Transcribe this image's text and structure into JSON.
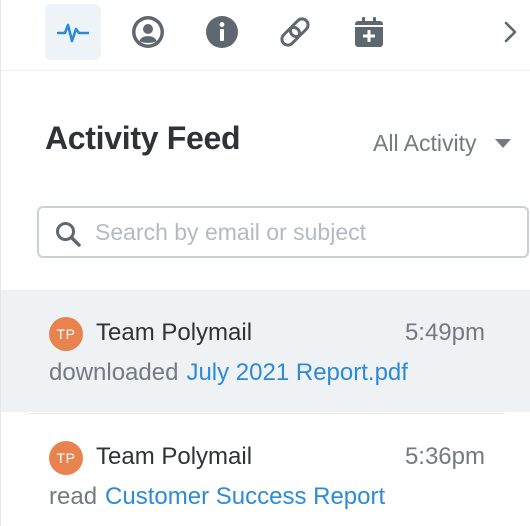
{
  "toolbar": {
    "tabs": [
      {
        "icon": "activity-icon",
        "active": true
      },
      {
        "icon": "profile-icon",
        "active": false
      },
      {
        "icon": "info-icon",
        "active": false
      },
      {
        "icon": "attachment-icon",
        "active": false
      },
      {
        "icon": "add-calendar-icon",
        "active": false
      }
    ],
    "more_icon": "chevron-right-icon"
  },
  "header": {
    "title": "Activity Feed",
    "filter_label": "All Activity"
  },
  "search": {
    "placeholder": "Search by email or subject",
    "value": ""
  },
  "feed": [
    {
      "avatar_initials": "TP",
      "name": "Team Polymail",
      "time": "5:49pm",
      "action": "downloaded",
      "target": "July 2021 Report.pdf",
      "highlighted": true
    },
    {
      "avatar_initials": "TP",
      "name": "Team Polymail",
      "time": "5:36pm",
      "action": "read",
      "target": "Customer Success Report",
      "highlighted": false
    }
  ],
  "colors": {
    "accent": "#2d8ad6",
    "avatar": "#e8834f",
    "icon": "#5f6870",
    "highlight_bg": "#eff2f5"
  }
}
